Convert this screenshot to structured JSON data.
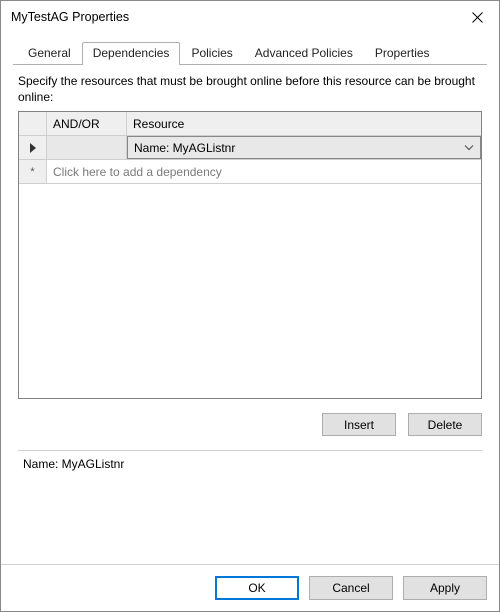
{
  "titlebar": {
    "title": "MyTestAG Properties"
  },
  "tabs": {
    "general": "General",
    "dependencies": "Dependencies",
    "policies": "Policies",
    "advanced_policies": "Advanced Policies",
    "properties": "Properties"
  },
  "page": {
    "instruction": "Specify the resources that must be brought online before this resource can be brought online:",
    "headers": {
      "andor": "AND/OR",
      "resource": "Resource"
    },
    "rows": [
      {
        "andor": "",
        "resource": "Name: MyAGListnr"
      }
    ],
    "placeholder_row": "Click here to add a dependency",
    "buttons": {
      "insert": "Insert",
      "delete": "Delete"
    },
    "detail_name": "Name: MyAGListnr"
  },
  "footer": {
    "ok": "OK",
    "cancel": "Cancel",
    "apply": "Apply"
  }
}
